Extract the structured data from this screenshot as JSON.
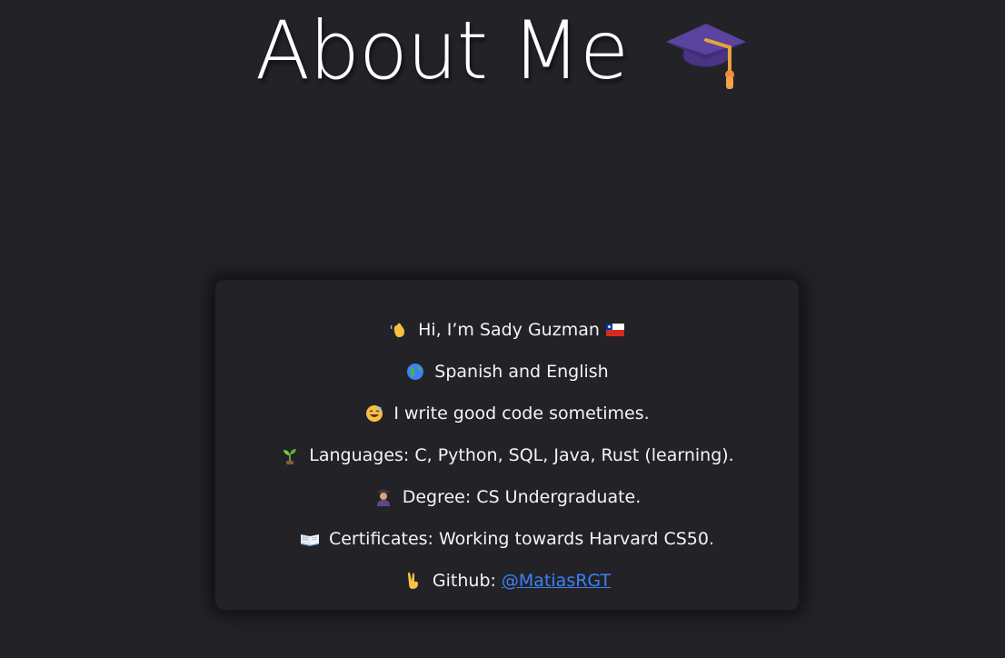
{
  "header": {
    "title": "About Me",
    "title_emoji": "graduation-cap-icon"
  },
  "card": {
    "lines": [
      {
        "icon": "waving-hand-icon",
        "text": "Hi, I’m Sady Guzman",
        "trailing_icon": "chile-flag-icon"
      },
      {
        "icon": "globe-icon",
        "text": "Spanish and English"
      },
      {
        "icon": "grinning-sweat-face-icon",
        "text": "I write good code sometimes."
      },
      {
        "icon": "seedling-icon",
        "text": "Languages: C, Python, SQL, Java, Rust (learning)."
      },
      {
        "icon": "student-icon",
        "text": "Degree: CS Undergraduate."
      },
      {
        "icon": "open-book-icon",
        "text": "Certificates: Working towards Harvard CS50."
      },
      {
        "icon": "victory-hand-icon",
        "text": "Github:",
        "link_text": "@MatiasRGT"
      }
    ]
  },
  "colors": {
    "background": "#232227",
    "text": "#ffffff",
    "link": "#3b82f6"
  }
}
